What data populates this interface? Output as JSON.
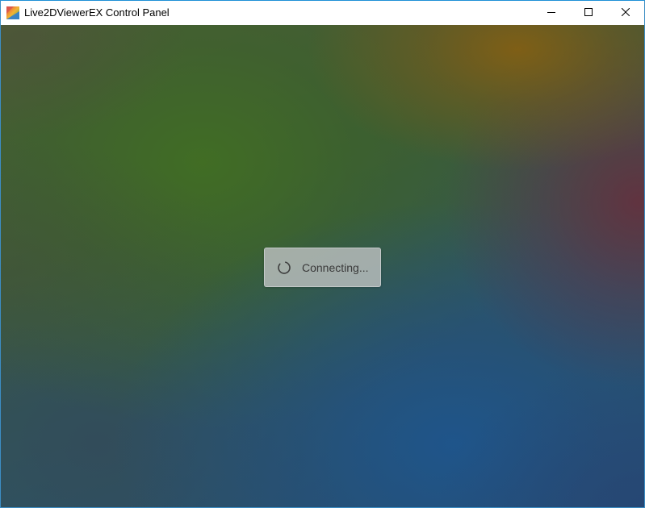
{
  "window": {
    "title": "Live2DViewerEX Control Panel",
    "app_icon": "live2dviewerex-app-icon",
    "controls": {
      "minimize_icon": "minimize-icon",
      "maximize_icon": "maximize-icon",
      "close_icon": "close-icon"
    }
  },
  "main": {
    "status": {
      "icon": "spinner-icon",
      "text": "Connecting..."
    }
  },
  "colors": {
    "titlebar_bg": "#ffffff",
    "window_border": "#1e90d6",
    "toast_bg": "#bcc0c0",
    "toast_text": "#3a3a3a"
  }
}
